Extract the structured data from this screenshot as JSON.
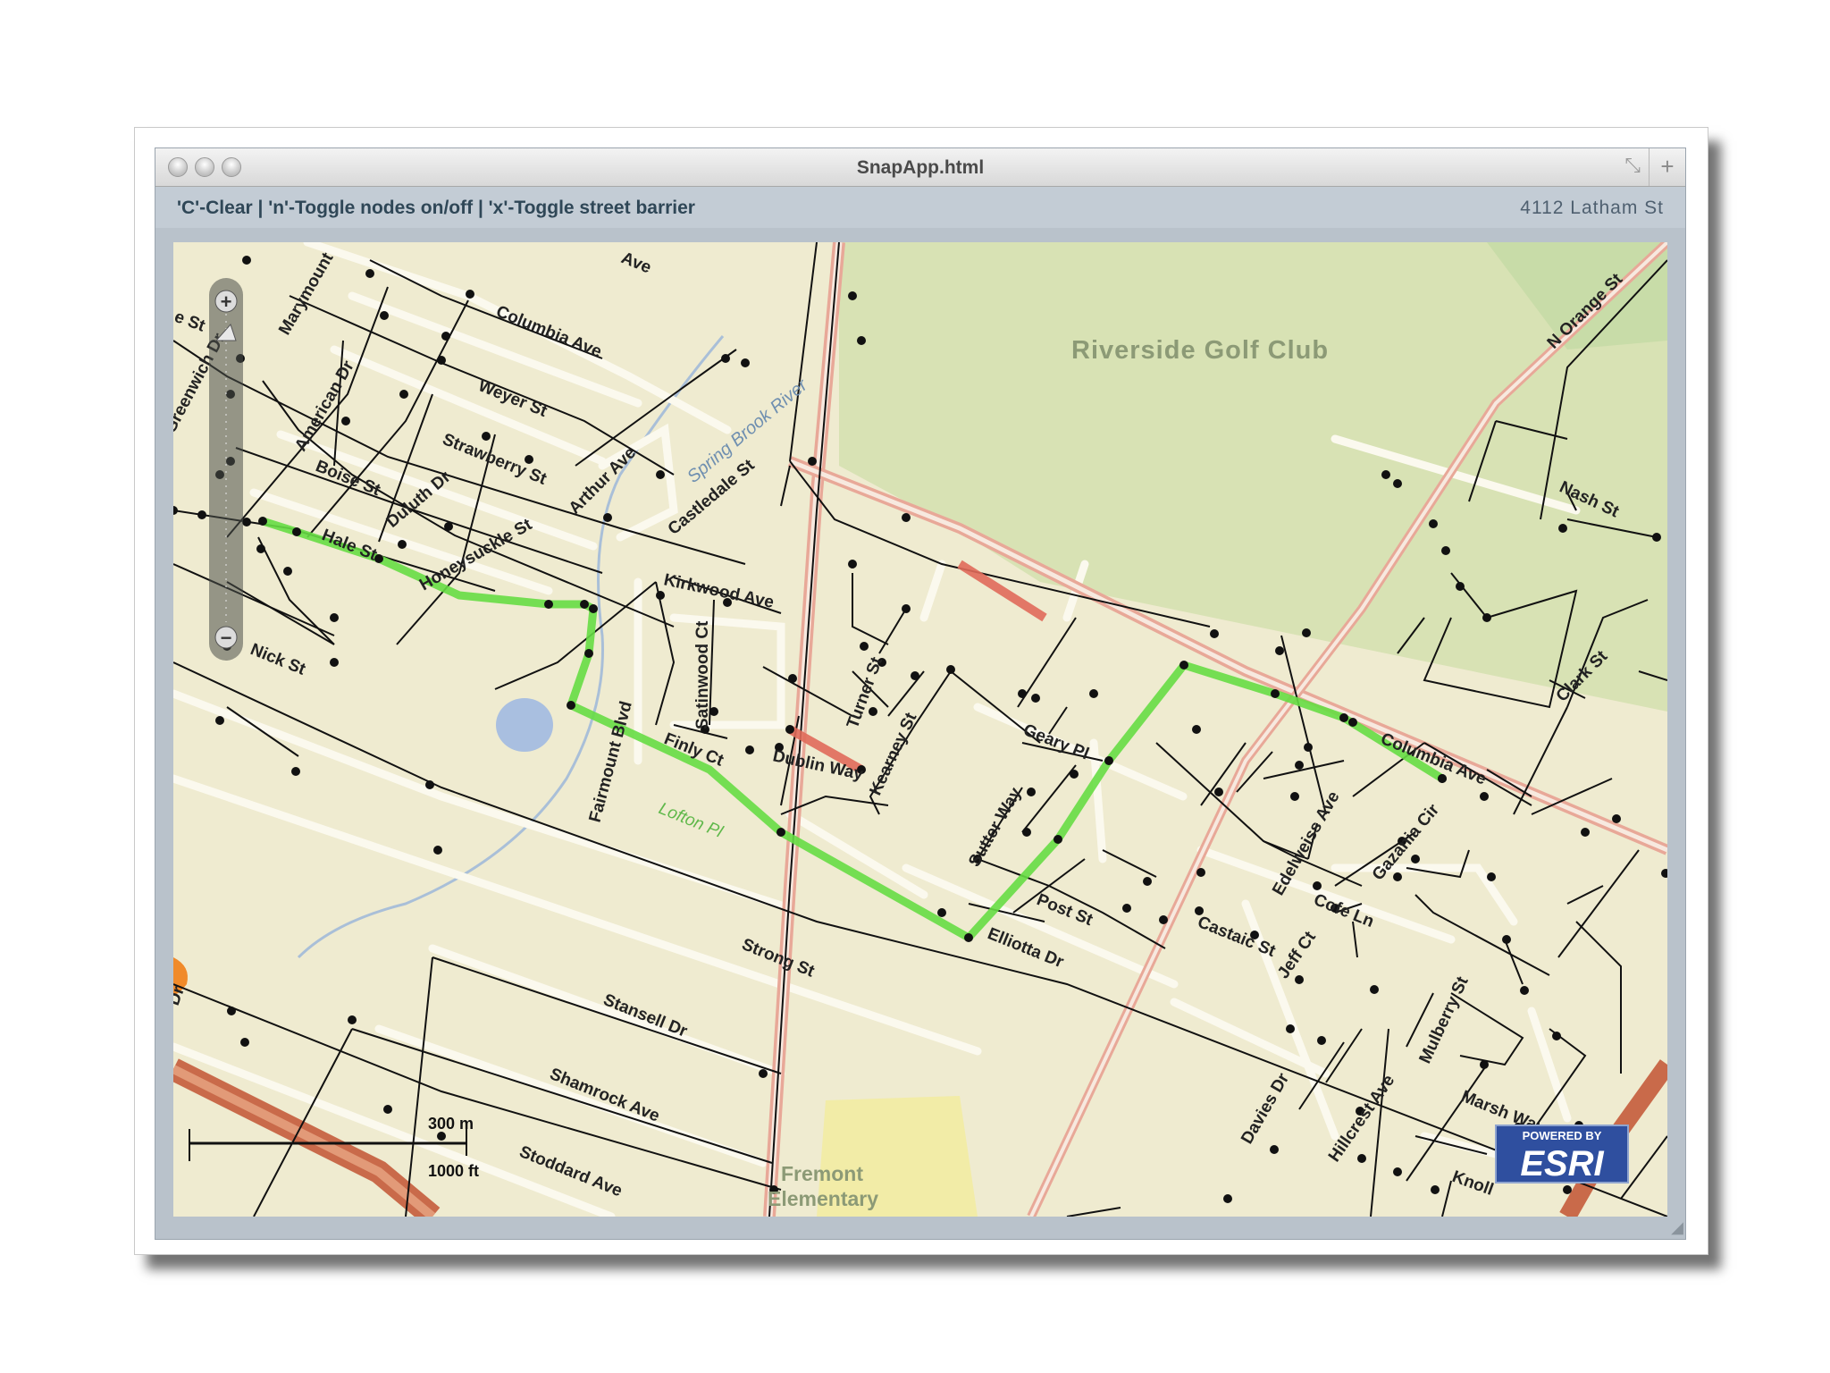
{
  "window": {
    "title": "SnapApp.html"
  },
  "toolbar": {
    "hint": "'C'-Clear | 'n'-Toggle nodes on/off | 'x'-Toggle street barrier",
    "address": "4112 Latham St"
  },
  "map": {
    "labels": {
      "golf": "Riverside Golf Club",
      "river": "Spring Brook River",
      "school_1": "Fremont",
      "school_2": "Elementary",
      "columbia_1": "Columbia Ave",
      "columbia_2": "Columbia Ave",
      "marymount": "Marymount",
      "greenwich": "Greenwich Dr",
      "american": "American Dr",
      "weyer": "Weyer St",
      "strawberry": "Strawberry St",
      "arthur": "Arthur Ave",
      "boise": "Boise St",
      "duluth": "Duluth Dr",
      "honeysuckle": "Honeysuckle St",
      "hale": "Hale St",
      "castledale": "Castledale St",
      "kirkwood": "Kirkwood Ave",
      "satinwood": "Satinwood Ct",
      "fairmount": "Fairmount Blvd",
      "finly": "Finly Ct",
      "lofton": "Lofton Pl",
      "dublin": "Dublin Way",
      "turner": "Turner St",
      "kearney": "Kearney St",
      "sutter": "Sutter Way",
      "geary": "Geary Pl",
      "post": "Post St",
      "elliotta": "Elliotta Dr",
      "castaic": "Castaic St",
      "edelweiss": "Edelweiss Ave",
      "gazania": "Gazania Cir",
      "cofe": "Cofe Ln",
      "jeff": "Jeff Ct",
      "mulberry": "Mulberry St",
      "marsh": "Marsh Way",
      "hillcrest": "Hillcrest Ave",
      "davies": "Davies Dr",
      "nick": "Nick St",
      "strong": "Strong St",
      "stansell": "Stansell Dr",
      "shamrock": "Shamrock Ave",
      "stoddard": "Stoddard Ave",
      "nash": "Nash St",
      "clark": "Clark St",
      "norange": "N Orange St",
      "knoll": "Knoll",
      "ave_top": "Ave",
      "st_left": "e St",
      "dr_left": "Dr"
    },
    "scale": {
      "metric": "300 m",
      "imperial": "1000 ft"
    },
    "attribution": {
      "top": "POWERED BY",
      "brand": "ESRI"
    },
    "zoom": {
      "in": "+",
      "out": "−"
    }
  },
  "colors": {
    "route": "#66dd44",
    "barrier": "#e06a5a",
    "major_road": "#e8b8a8",
    "park": "#d9e2b6",
    "water": "#a9bfe0"
  }
}
